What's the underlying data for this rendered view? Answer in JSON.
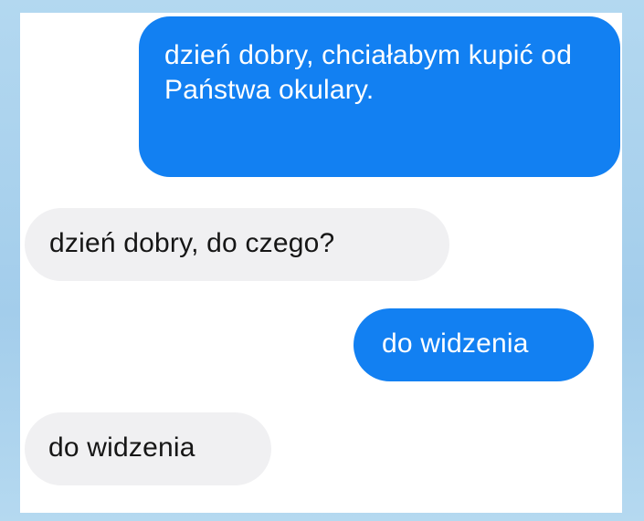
{
  "conversation": {
    "messages": [
      {
        "direction": "sent",
        "text": "dzień dobry, chciałabym kupić od Państwa okulary."
      },
      {
        "direction": "received",
        "text": "dzień dobry, do czego?"
      },
      {
        "direction": "sent",
        "text": "do widzenia"
      },
      {
        "direction": "received",
        "text": "do widzenia"
      }
    ]
  },
  "colors": {
    "sent_bubble": "#1280f2",
    "received_bubble": "#f0f0f2",
    "background": "#a9d2ee"
  }
}
